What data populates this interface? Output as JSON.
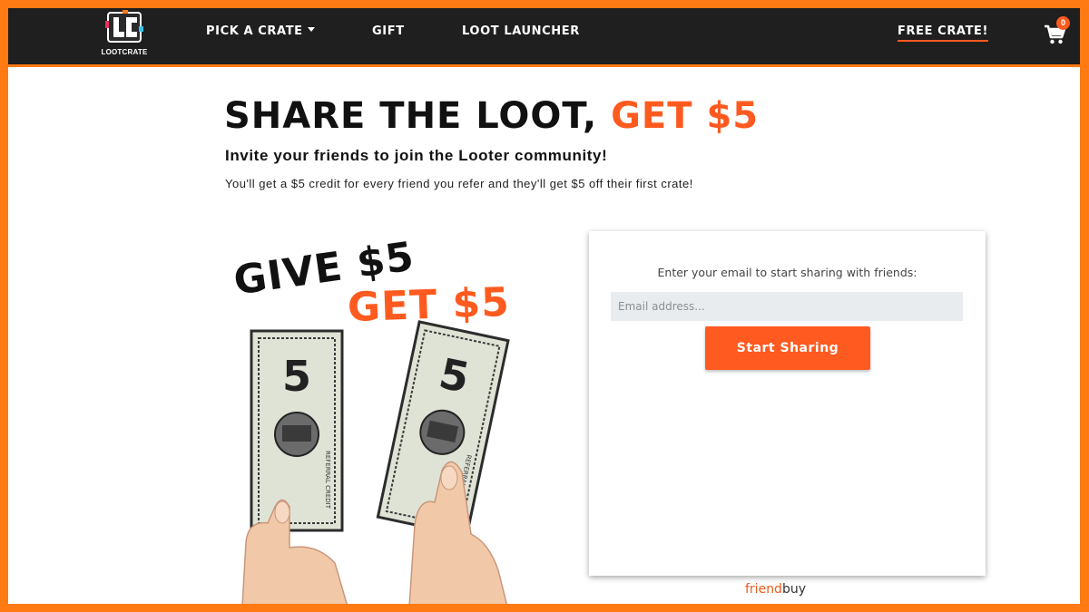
{
  "nav": {
    "logo_text": "LOOTCRATE",
    "items": [
      {
        "label": "PICK A CRATE",
        "has_dropdown": true
      },
      {
        "label": "GIFT"
      },
      {
        "label": "LOOT LAUNCHER"
      }
    ],
    "free_crate_label": "FREE CRATE!",
    "cart_icon": "cart-icon",
    "cart_count": "0"
  },
  "hero": {
    "title_main": "SHARE THE LOOT,",
    "title_accent": "GET $5",
    "subtitle": "Invite your friends to join the Looter community!",
    "description": "You'll get a $5 credit for every friend you refer and they'll get $5 off their first crate!"
  },
  "promo": {
    "give_label": "GIVE $5",
    "get_label": "GET $5",
    "bill_value": "5",
    "bill_caption": "REFERRAL CREDIT"
  },
  "form": {
    "prompt": "Enter your email to start sharing with friends:",
    "email_placeholder": "Email address...",
    "button_label": "Start Sharing"
  },
  "footer": {
    "brand_part1": "friend",
    "brand_part2": "buy"
  },
  "colors": {
    "accent": "#ff5a1f",
    "frame": "#ff7a12",
    "nav_bg": "#1f1f1f"
  }
}
